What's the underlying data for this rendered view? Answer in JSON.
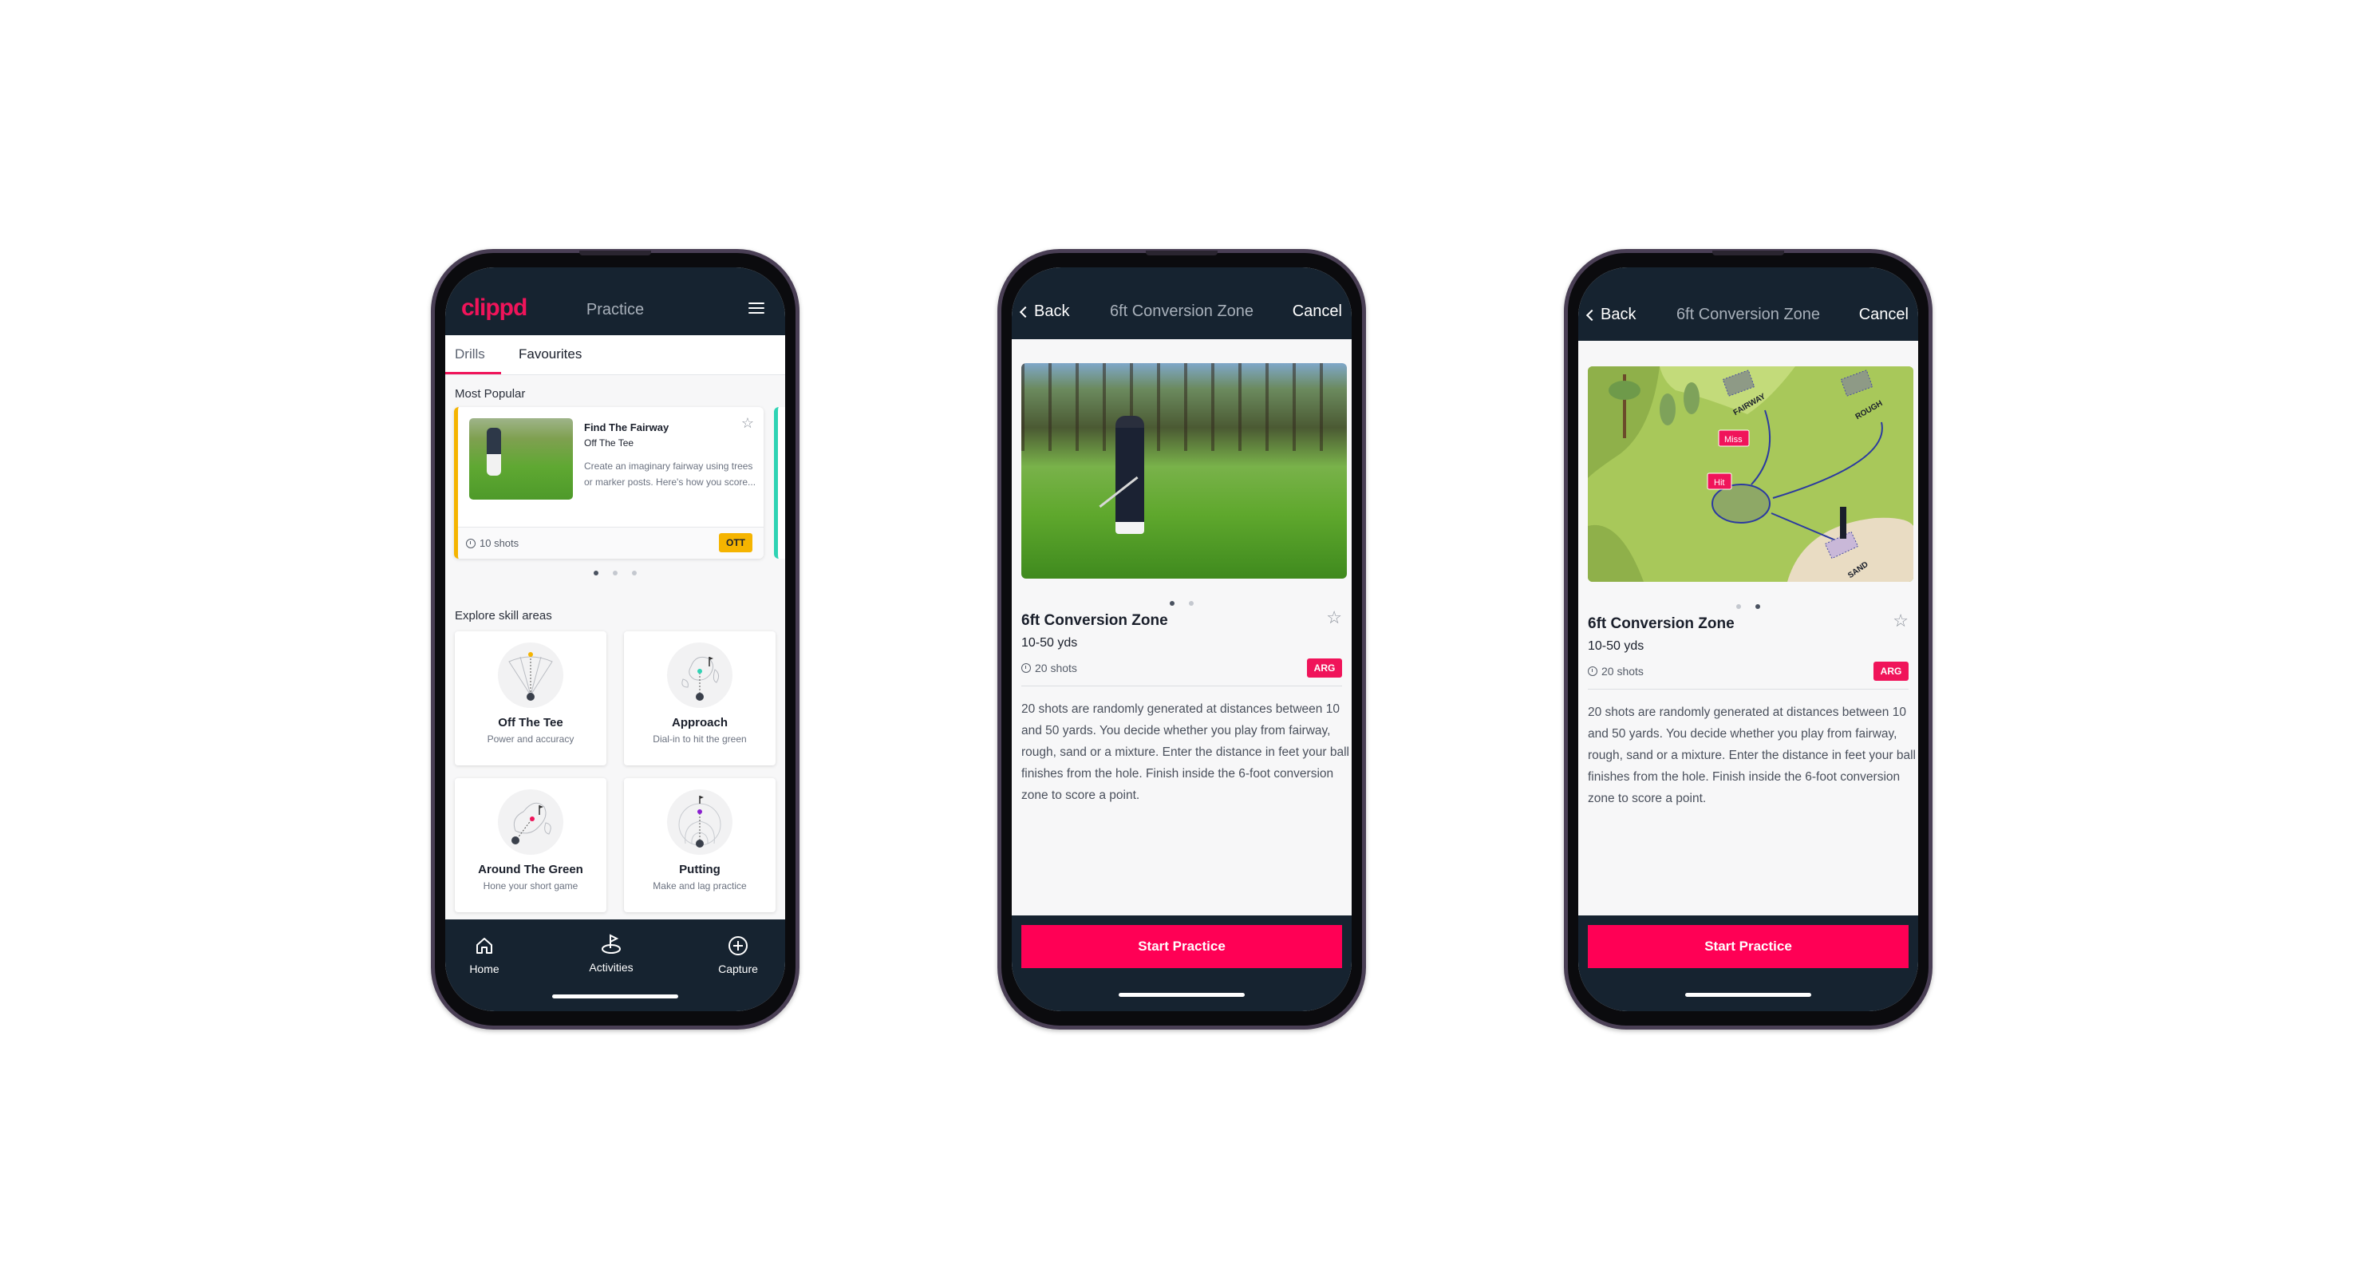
{
  "colors": {
    "brand": "#f0145a",
    "header_bg": "#162330",
    "cta": "#ff0055",
    "ott_badge": "#f5b400",
    "arg_badge": "#f0145a",
    "teal_accent": "#2fd3b4"
  },
  "phone1": {
    "header": {
      "logo": "clippd",
      "title": "Practice",
      "menu_icon": "hamburger-menu-icon"
    },
    "tabs": [
      {
        "label": "Drills",
        "active": true
      },
      {
        "label": "Favourites",
        "active": false
      }
    ],
    "most_popular": {
      "heading": "Most Popular",
      "card": {
        "title": "Find The Fairway",
        "subtitle": "Off The Tee",
        "description": "Create an imaginary fairway using trees or marker posts. Here's how you score...",
        "shots": "10 shots",
        "badge": "OTT",
        "favourite_icon": "star-outline-icon"
      },
      "carousel": {
        "count": 3,
        "active": 1
      }
    },
    "skill_areas": {
      "heading": "Explore skill areas",
      "items": [
        {
          "name": "Off The Tee",
          "description": "Power and accuracy",
          "accent": "#f5b400"
        },
        {
          "name": "Approach",
          "description": "Dial-in to hit the green",
          "accent": "#2fd3b4"
        },
        {
          "name": "Around The Green",
          "description": "Hone your short game",
          "accent": "#f0145a"
        },
        {
          "name": "Putting",
          "description": "Make and lag practice",
          "accent": "#8a1fd0"
        }
      ]
    },
    "bottom_nav": [
      {
        "label": "Home",
        "icon": "home-icon"
      },
      {
        "label": "Activities",
        "icon": "golf-flag-icon",
        "active": true
      },
      {
        "label": "Capture",
        "icon": "plus-circle-icon"
      }
    ]
  },
  "detail": {
    "back_label": "Back",
    "title": "6ft Conversion Zone",
    "cancel_label": "Cancel",
    "drill_name": "6ft Conversion Zone",
    "range": "10-50 yds",
    "shots": "20 shots",
    "badge": "ARG",
    "description": "20 shots are randomly generated at distances between 10 and 50 yards. You decide whether you play from fairway, rough, sand or a mixture. Enter the distance in feet your ball finishes from the hole. Finish inside the 6-foot conversion zone to score a point.",
    "start_label": "Start Practice"
  },
  "phone2": {
    "media": "golfer-photo",
    "carousel": {
      "count": 2,
      "active": 1
    }
  },
  "phone3": {
    "media": "course-illustration",
    "carousel": {
      "count": 2,
      "active": 2
    },
    "illustration_labels": {
      "fairway": "FAIRWAY",
      "rough": "ROUGH",
      "sand": "SAND",
      "miss": "Miss",
      "hit": "Hit"
    }
  }
}
